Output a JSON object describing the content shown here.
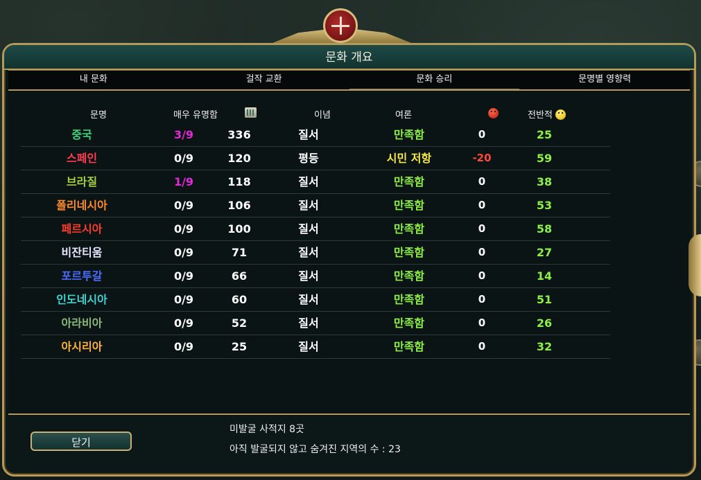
{
  "window": {
    "title": "문화 개요"
  },
  "tabs": [
    {
      "label": "내 문화",
      "active": false
    },
    {
      "label": "걸작 교환",
      "active": false
    },
    {
      "label": "문화 승리",
      "active": true
    },
    {
      "label": "문명별 영향력",
      "active": false
    }
  ],
  "headers": {
    "civ": "문명",
    "famous": "매우 유명함",
    "tourism_icon": "tourism-icon",
    "ideology": "이념",
    "opinion": "여론",
    "unhappy_icon": "unhappy-icon",
    "overall": "전반적",
    "happy_icon": "happy-icon"
  },
  "rows": [
    {
      "civ": "중국",
      "civ_color": "#3fd27a",
      "famous": "3/9",
      "famous_color": "#e02ad8",
      "tourism": "336",
      "ideology": "질서",
      "opinion": "만족함",
      "opinion_color": "#8cf048",
      "unhappy": "0",
      "unhappy_color": "#ffffff",
      "overall": "25"
    },
    {
      "civ": "스페인",
      "civ_color": "#ff3d50",
      "famous": "0/9",
      "famous_color": "#ffffff",
      "tourism": "120",
      "ideology": "평등",
      "opinion": "시민 저항",
      "opinion_color": "#f4e84a",
      "unhappy": "-20",
      "unhappy_color": "#ff4a3a",
      "overall": "59"
    },
    {
      "civ": "브라질",
      "civ_color": "#a6d13c",
      "famous": "1/9",
      "famous_color": "#e02ad8",
      "tourism": "118",
      "ideology": "질서",
      "opinion": "만족함",
      "opinion_color": "#8cf048",
      "unhappy": "0",
      "unhappy_color": "#ffffff",
      "overall": "38"
    },
    {
      "civ": "폴리네시아",
      "civ_color": "#ff8a2a",
      "famous": "0/9",
      "famous_color": "#ffffff",
      "tourism": "106",
      "ideology": "질서",
      "opinion": "만족함",
      "opinion_color": "#8cf048",
      "unhappy": "0",
      "unhappy_color": "#ffffff",
      "overall": "53"
    },
    {
      "civ": "페르시아",
      "civ_color": "#ff3b2a",
      "famous": "0/9",
      "famous_color": "#ffffff",
      "tourism": "100",
      "ideology": "질서",
      "opinion": "만족함",
      "opinion_color": "#8cf048",
      "unhappy": "0",
      "unhappy_color": "#ffffff",
      "overall": "58"
    },
    {
      "civ": "비잔티움",
      "civ_color": "#e6e6ff",
      "famous": "0/9",
      "famous_color": "#ffffff",
      "tourism": "71",
      "ideology": "질서",
      "opinion": "만족함",
      "opinion_color": "#8cf048",
      "unhappy": "0",
      "unhappy_color": "#ffffff",
      "overall": "27"
    },
    {
      "civ": "포르투갈",
      "civ_color": "#4a6cff",
      "famous": "0/9",
      "famous_color": "#ffffff",
      "tourism": "66",
      "ideology": "질서",
      "opinion": "만족함",
      "opinion_color": "#8cf048",
      "unhappy": "0",
      "unhappy_color": "#ffffff",
      "overall": "14"
    },
    {
      "civ": "인도네시아",
      "civ_color": "#3ed4d0",
      "famous": "0/9",
      "famous_color": "#ffffff",
      "tourism": "60",
      "ideology": "질서",
      "opinion": "만족함",
      "opinion_color": "#8cf048",
      "unhappy": "0",
      "unhappy_color": "#ffffff",
      "overall": "51"
    },
    {
      "civ": "아라비아",
      "civ_color": "#8ab87a",
      "famous": "0/9",
      "famous_color": "#ffffff",
      "tourism": "52",
      "ideology": "질서",
      "opinion": "만족함",
      "opinion_color": "#8cf048",
      "unhappy": "0",
      "unhappy_color": "#ffffff",
      "overall": "26"
    },
    {
      "civ": "아시리아",
      "civ_color": "#ffb23a",
      "famous": "0/9",
      "famous_color": "#ffffff",
      "tourism": "25",
      "ideology": "질서",
      "opinion": "만족함",
      "opinion_color": "#8cf048",
      "unhappy": "0",
      "unhappy_color": "#ffffff",
      "overall": "32"
    }
  ],
  "overall_color": "#8cf048",
  "footer": {
    "undiscovered_sites": "미발굴 사적지 8곳",
    "hidden_sites": "아직 발굴되지 않고 숨겨진 지역의 수 : 23",
    "close_label": "닫기"
  }
}
